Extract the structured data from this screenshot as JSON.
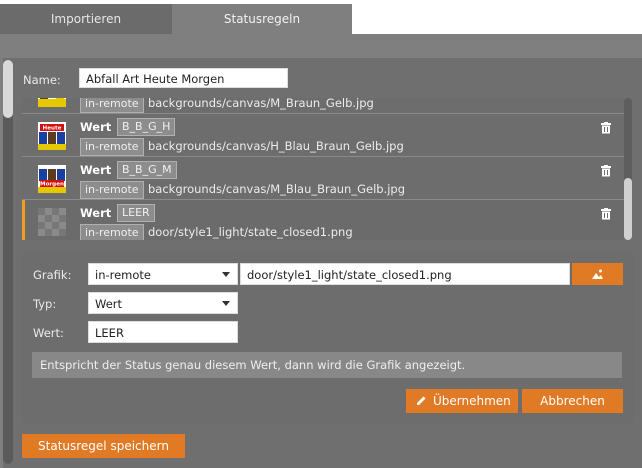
{
  "tabs": [
    {
      "label": "Importieren"
    },
    {
      "label": "Statusregeln"
    }
  ],
  "form": {
    "name_label": "Name:",
    "name_value": "Abfall Art Heute Morgen"
  },
  "rules": [
    {
      "title": "",
      "value": "",
      "source": "in-remote",
      "path": "backgrounds/canvas/M_Braun_Gelb.jpg",
      "thumb": "partial"
    },
    {
      "title": "Wert",
      "value": "B_B_G_H",
      "source": "in-remote",
      "path": "backgrounds/canvas/H_Blau_Braun_Gelb.jpg",
      "thumb": "heute",
      "thumb_text": "Heute"
    },
    {
      "title": "Wert",
      "value": "B_B_G_M",
      "source": "in-remote",
      "path": "backgrounds/canvas/M_Blau_Braun_Gelb.jpg",
      "thumb": "morgen",
      "thumb_text": "Morgen"
    },
    {
      "title": "Wert",
      "value": "LEER",
      "source": "in-remote",
      "path": "door/style1_light/state_closed1.png",
      "thumb": "checker",
      "selected": true
    }
  ],
  "editor": {
    "grafik_label": "Grafik:",
    "grafik_source": "in-remote",
    "grafik_path": "door/style1_light/state_closed1.png",
    "typ_label": "Typ:",
    "typ_value": "Wert",
    "wert_label": "Wert:",
    "wert_value": "LEER",
    "note": "Entspricht der Status genau diesem Wert, dann wird die Grafik angezeigt.",
    "apply_label": "Übernehmen",
    "cancel_label": "Abbrechen"
  },
  "save_label": "Statusregel speichern",
  "colors": {
    "accent": "#e07a24",
    "selection": "#f0a020"
  },
  "icons": {
    "trash": "trash-icon",
    "pencil": "pencil-icon",
    "image_picker": "image-picker-icon"
  }
}
